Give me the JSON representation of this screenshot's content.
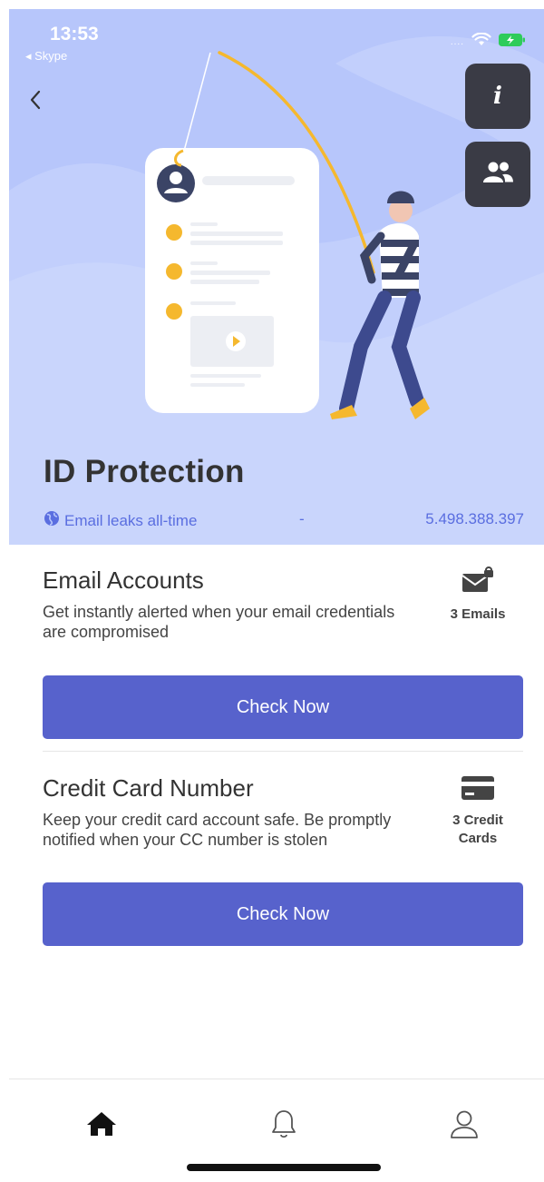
{
  "status_bar": {
    "time": "13:53",
    "back_app": "◂ Skype",
    "signal_dots": "....",
    "icons": [
      "wifi-icon",
      "battery-charging-icon"
    ]
  },
  "header": {
    "back_icon": "chevron-left-icon",
    "info_button_icon": "info-icon",
    "users_button_icon": "users-icon"
  },
  "hero": {
    "title": "ID Protection",
    "leaks_label": "Email leaks all-time",
    "leaks_separator": "-",
    "leaks_value": "5.498.388.397",
    "leaks_icon": "globe-icon"
  },
  "email_card": {
    "title": "Email Accounts",
    "description": "Get instantly alerted when your email credentials are compromised",
    "badge_icon": "email-lock-icon",
    "badge_text": "3 Emails",
    "button_label": "Check Now"
  },
  "card_card": {
    "title": "Credit Card Number",
    "description": "Keep your credit card account safe. Be promptly notified when your CC number is stolen",
    "badge_icon": "credit-card-icon",
    "badge_text": "3 Credit Cards",
    "button_label": "Check Now"
  },
  "tab_bar": {
    "items": [
      {
        "icon": "home-icon",
        "active": true
      },
      {
        "icon": "bell-icon",
        "active": false
      },
      {
        "icon": "profile-icon",
        "active": false
      }
    ]
  },
  "colors": {
    "hero_bg": "#b7c6fb",
    "accent_blue": "#5762cc",
    "leaks_text": "#5a6ee0",
    "fab_bg": "#3a3b45",
    "illustration_yellow": "#f5b82e"
  }
}
